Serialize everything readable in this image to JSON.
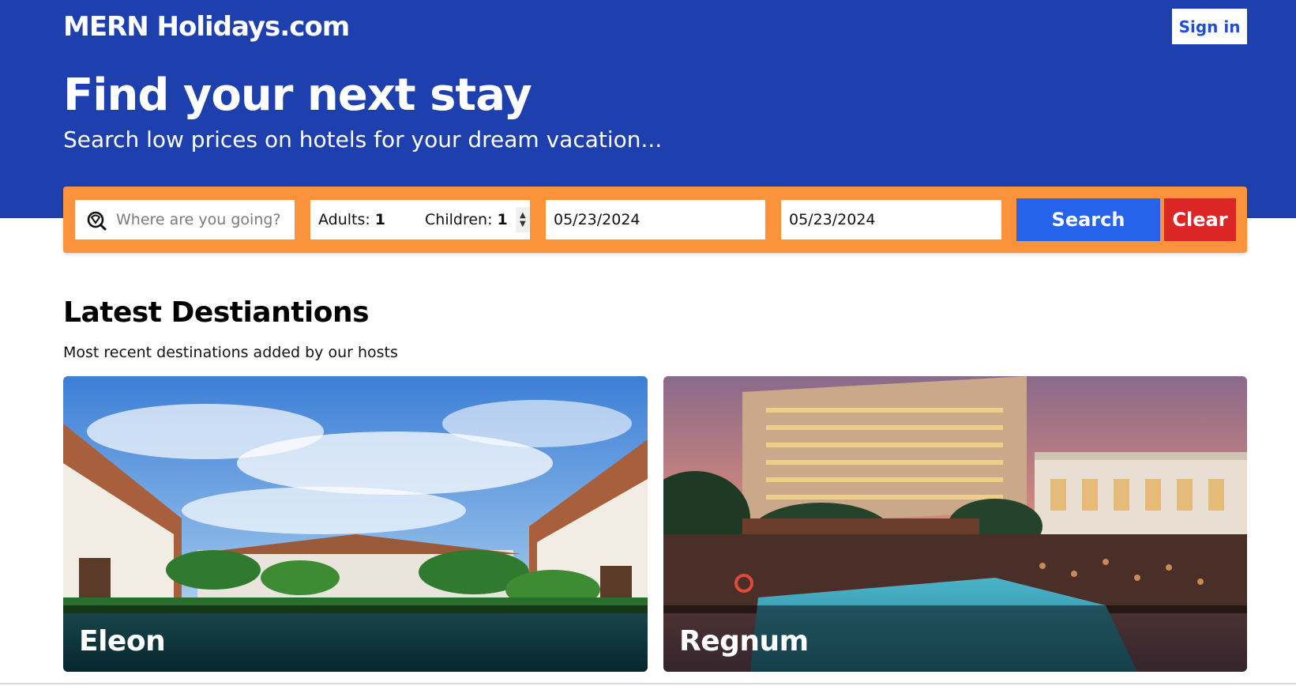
{
  "header": {
    "logo": "MERN Holidays.com",
    "sign_in_label": "Sign in"
  },
  "hero": {
    "title": "Find your next stay",
    "subtitle": "Search low prices on hotels for your dream vacation..."
  },
  "search": {
    "destination_placeholder": "Where are you going?",
    "adults_label": "Adults:",
    "adults_value": "1",
    "children_label": "Children:",
    "children_value": "1",
    "check_in": "05/23/2024",
    "check_out": "05/23/2024",
    "search_label": "Search",
    "clear_label": "Clear"
  },
  "latest": {
    "title": "Latest Destiantions",
    "subtitle": "Most recent destinations added by our hosts",
    "cards": [
      {
        "name": "Eleon"
      },
      {
        "name": "Regnum"
      }
    ]
  },
  "colors": {
    "hero_bg": "#1e40af",
    "search_bar": "#fb923c",
    "search_button": "#2563eb",
    "clear_button": "#dc2626"
  },
  "icons": {
    "destination": "search-location-icon",
    "spinner": "spinner-arrows-icon"
  }
}
